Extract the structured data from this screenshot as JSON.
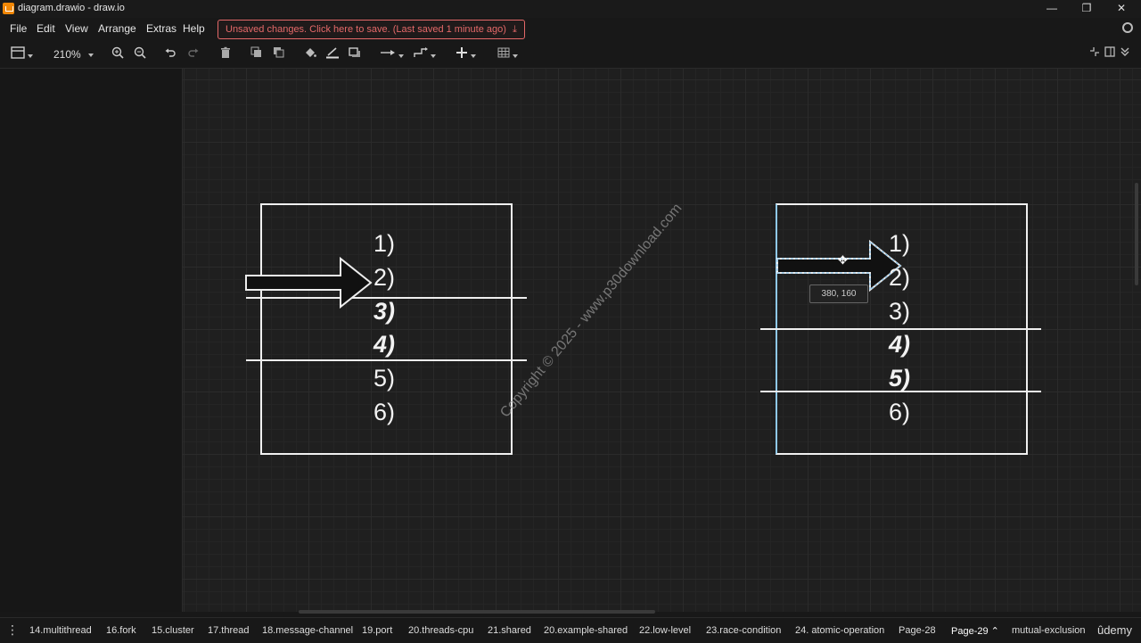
{
  "window": {
    "title": "diagram.drawio - draw.io",
    "minimize": "—",
    "maximize": "❐",
    "close": "✕"
  },
  "menu": [
    "File",
    "Edit",
    "View",
    "Arrange",
    "Extras",
    "Help"
  ],
  "unsaved_notice": "Unsaved changes. Click here to save. (Last saved 1 minute ago)",
  "toolbar": {
    "zoom": "210%"
  },
  "icons": {
    "format-panel": "sidebar-toggle-icon",
    "zoom-in": "zoom-in-icon",
    "zoom-out": "zoom-out-icon",
    "undo": "undo-icon",
    "redo": "redo-icon",
    "delete": "trash-icon",
    "to-front": "to-front-icon",
    "to-back": "to-back-icon",
    "fill": "fill-color-icon",
    "line": "line-color-icon",
    "shadow": "shadow-icon",
    "connection": "connection-icon",
    "waypoints": "waypoints-icon",
    "insert": "plus-icon",
    "table": "table-icon"
  },
  "diagram": {
    "left_items": [
      {
        "text": "1)",
        "style": "normal"
      },
      {
        "text": "2)",
        "style": "normal"
      },
      {
        "text": "3)",
        "style": "bold-italic"
      },
      {
        "text": "4)",
        "style": "bold-italic"
      },
      {
        "text": "5)",
        "style": "normal"
      },
      {
        "text": "6)",
        "style": "normal"
      }
    ],
    "right_items": [
      {
        "text": "1)",
        "style": "normal"
      },
      {
        "text": "2)",
        "style": "normal"
      },
      {
        "text": "3)",
        "style": "normal"
      },
      {
        "text": "4)",
        "style": "bold-italic"
      },
      {
        "text": "5)",
        "style": "bold-italic"
      },
      {
        "text": "6)",
        "style": "normal"
      }
    ],
    "coord_tooltip": "380, 160",
    "watermark": "Copyright © 2025 - www.p30download.com"
  },
  "pages": [
    "14.multithread",
    "16.fork",
    "15.cluster",
    "17.thread",
    "18.message-channel",
    "19.port",
    "20.threads-cpu",
    "21.shared",
    "20.example-shared",
    "22.low-level",
    "23.race-condition",
    "24. atomic-operation",
    "Page-28",
    "Page-29",
    "mutual-exclusion"
  ],
  "active_page": "Page-29",
  "branding": "ûdemy"
}
